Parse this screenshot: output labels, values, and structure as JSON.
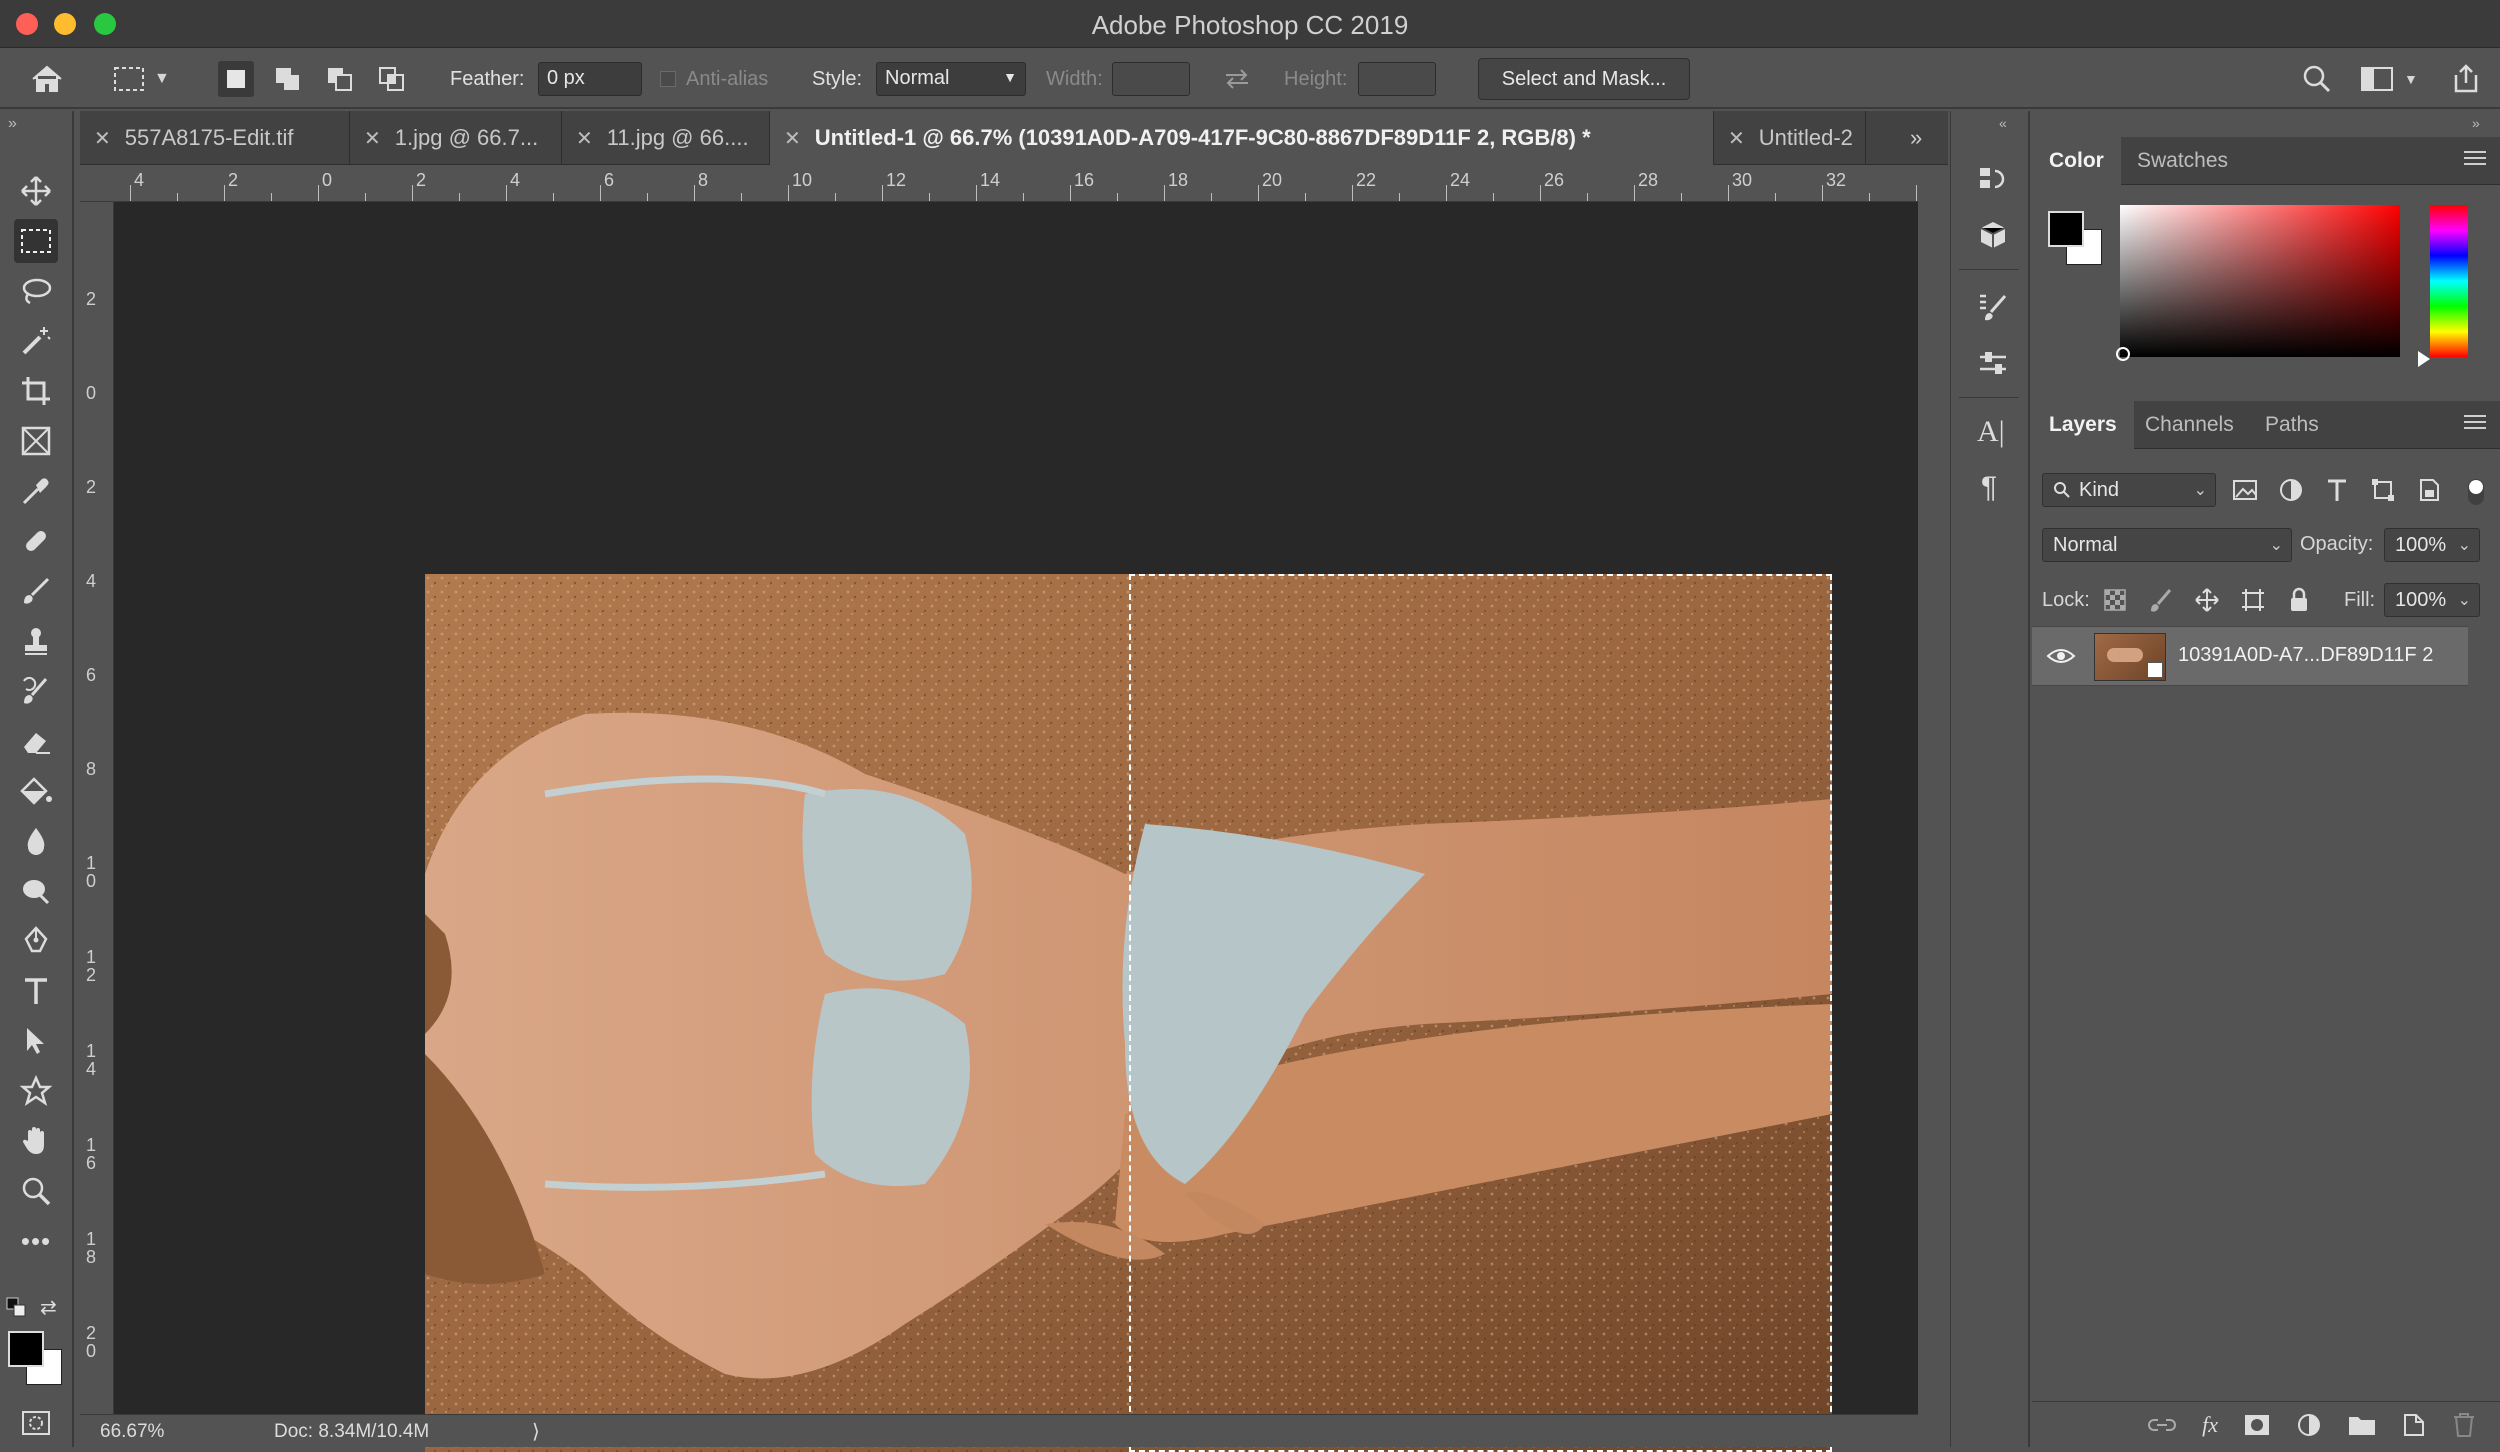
{
  "app": {
    "title": "Adobe Photoshop CC 2019"
  },
  "options_bar": {
    "feather_label": "Feather:",
    "feather_value": "0 px",
    "anti_alias_label": "Anti-alias",
    "style_label": "Style:",
    "style_value": "Normal",
    "width_label": "Width:",
    "height_label": "Height:",
    "select_mask_label": "Select and Mask..."
  },
  "tabs": [
    {
      "label": "557A8175-Edit.tif"
    },
    {
      "label": "1.jpg @ 66.7..."
    },
    {
      "label": "11.jpg @ 66...."
    },
    {
      "label": "Untitled-1 @ 66.7% (10391A0D-A709-417F-9C80-8867DF89D11F 2, RGB/8) *"
    },
    {
      "label": "Untitled-2"
    }
  ],
  "ruler": {
    "top_ticks": [
      "4",
      "2",
      "0",
      "2",
      "4",
      "6",
      "8",
      "10",
      "12",
      "14",
      "16",
      "18",
      "20",
      "22",
      "24",
      "26",
      "28",
      "30",
      "32"
    ],
    "left_ticks": [
      "2",
      "0",
      "2",
      "4",
      "6",
      "8",
      "10",
      "12",
      "14",
      "16",
      "18",
      "20"
    ]
  },
  "status": {
    "zoom": "66.67%",
    "doc": "Doc: 8.34M/10.4M"
  },
  "color_panel": {
    "tabs": [
      "Color",
      "Swatches"
    ]
  },
  "layers_panel": {
    "tabs": [
      "Layers",
      "Channels",
      "Paths"
    ],
    "filter_kind": "Kind",
    "blend_mode": "Normal",
    "opacity_label": "Opacity:",
    "opacity_value": "100%",
    "lock_label": "Lock:",
    "fill_label": "Fill:",
    "fill_value": "100%",
    "layers": [
      {
        "name": "10391A0D-A7...DF89D11F 2"
      }
    ]
  },
  "colors": {
    "accent_selection": "#ffffff",
    "bg_panel": "#535353",
    "canvas_bg": "#282828"
  }
}
